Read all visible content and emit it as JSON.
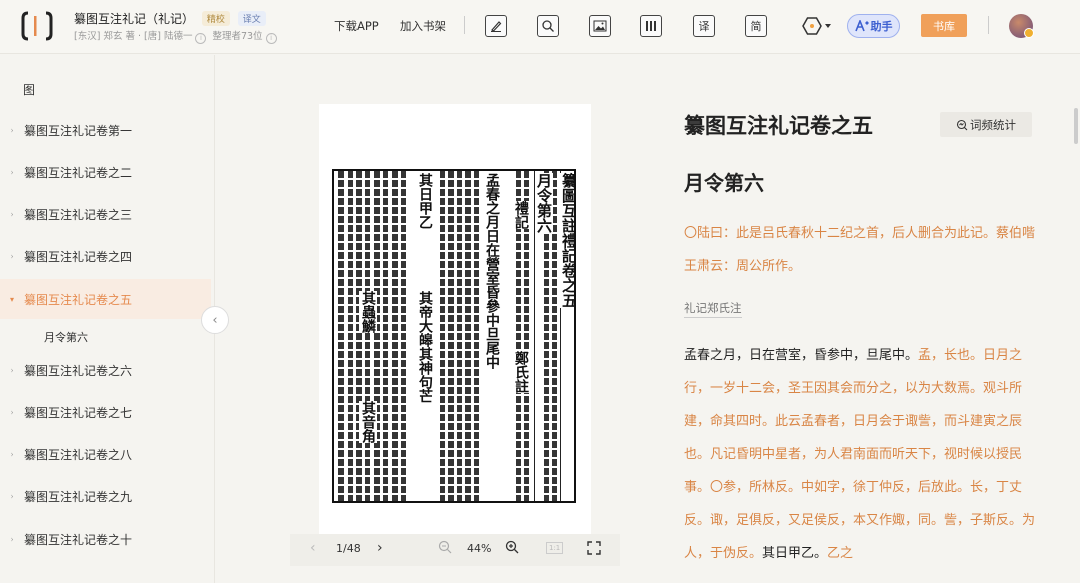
{
  "header": {
    "title": "纂图互注礼记（礼记）",
    "badge_jx": "精校",
    "badge_yw": "译文",
    "meta_author": "[东汉] 郑玄 著 · [唐] 陆德一",
    "meta_count": "整理者73位",
    "download_app": "下载APP",
    "add_shelf": "加入书架",
    "tool_translate": "译",
    "tool_simplified": "简",
    "ai_label": "助手",
    "library_label": "书库"
  },
  "sidebar": {
    "heading": "图",
    "items": [
      "纂图互注礼记卷第一",
      "纂图互注礼记卷之二",
      "纂图互注礼记卷之三",
      "纂图互注礼记卷之四",
      "纂图互注礼记卷之五",
      "纂图互注礼记卷之六",
      "纂图互注礼记卷之七",
      "纂图互注礼记卷之八",
      "纂图互注礼记卷之九",
      "纂图互注礼记卷之十"
    ],
    "sub_item": "月令第六",
    "active_index": 4
  },
  "viewer": {
    "page": "1/48",
    "zoom": "44%",
    "fit_label": "1:1",
    "scan_text": {
      "title": "纂圖互註禮記卷之五",
      "chapter": "月令第六",
      "liji": "禮記",
      "zheng": "鄭氏註",
      "line1": "孟春之月日在營室昏參中旦尾中",
      "line2": "其日甲乙",
      "line3": "其帝大皞其神句芒",
      "line4": "其蟲鱗",
      "line5": "其音角"
    }
  },
  "reader": {
    "title": "纂图互注礼记卷之五",
    "freq_button": "词频统计",
    "chapter": "月令第六",
    "note1": "〇陆曰：此是吕氏春秋十二纪之首，后人删合为此记。蔡伯喈王肃云：周公所作。",
    "label": "礼记郑氏注",
    "main_black": "孟春之月，日在营室，昏参中，旦尾中。",
    "main_orange": "孟，长也。日月之行，一岁十二会，圣王因其会而分之，以为大数焉。观斗所建，命其四时。此云孟春者，日月会于诹訾，而斗建寅之辰也。凡记昏明中星者，为人君南面而听天下，视时候以授民事。〇参，所林反。中如字，徐丁仲反，后放此。长，丁丈反。诹，足俱反，又足侯反，本又作娵，同。訾，子斯反。为人，于伪反。",
    "main_black2": "其日甲乙。",
    "main_orange2": "乙之"
  }
}
